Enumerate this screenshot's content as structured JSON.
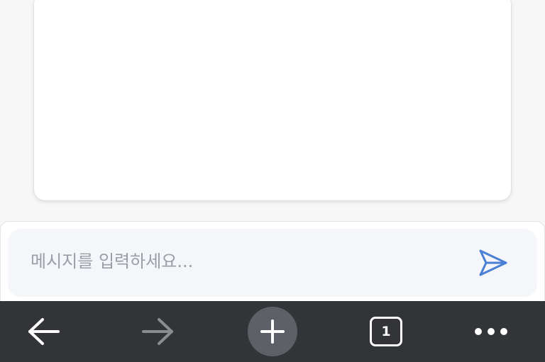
{
  "composer": {
    "placeholder": "메시지를 입력하세요...",
    "send_icon": "send-icon"
  },
  "navbar": {
    "back_icon": "arrow-left-icon",
    "forward_icon": "arrow-right-icon",
    "new_tab_icon": "plus-icon",
    "tab_count": "1",
    "menu_icon": "more-horizontal-icon"
  },
  "colors": {
    "accent": "#4a7fd4",
    "navbar_bg": "#323437",
    "new_tab_bg": "#5d6066",
    "forward_disabled": "#8a8c90"
  }
}
